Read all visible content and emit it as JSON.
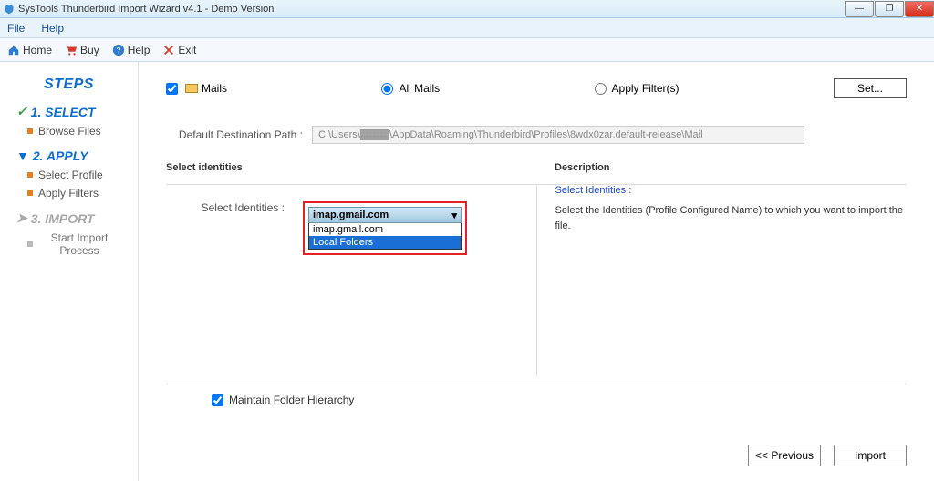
{
  "titlebar": {
    "title": "SysTools Thunderbird Import Wizard v4.1 - Demo Version"
  },
  "menubar": {
    "file": "File",
    "help": "Help"
  },
  "toolbar": {
    "home": "Home",
    "buy": "Buy",
    "help": "Help",
    "exit": "Exit"
  },
  "sidebar": {
    "header": "STEPS",
    "step1": {
      "title": "1. SELECT",
      "sub1": "Browse Files"
    },
    "step2": {
      "title": "2. APPLY",
      "sub1": "Select Profile",
      "sub2": "Apply Filters"
    },
    "step3": {
      "title": "3. IMPORT",
      "sub1": "Start Import Process"
    }
  },
  "main": {
    "mails_label": "Mails",
    "all_mails": "All Mails",
    "apply_filters": "Apply Filter(s)",
    "set": "Set...",
    "dest_label": "Default Destination Path :",
    "dest_value": "C:\\Users\\▓▓▓▓\\AppData\\Roaming\\Thunderbird\\Profiles\\8wdx0zar.default-release\\Mail",
    "identities_legend": "Select identities",
    "select_identities": "Select Identities :",
    "dropdown": {
      "selected": "imap.gmail.com",
      "option1": "imap.gmail.com",
      "option2": "Local Folders"
    },
    "desc_legend": "Description",
    "desc_title": "Select Identities :",
    "desc_body": "Select the Identities (Profile Configured Name) to which you want to import the file.",
    "maintain": "Maintain Folder Hierarchy"
  },
  "footer": {
    "prev": "<< Previous",
    "import": "Import"
  }
}
